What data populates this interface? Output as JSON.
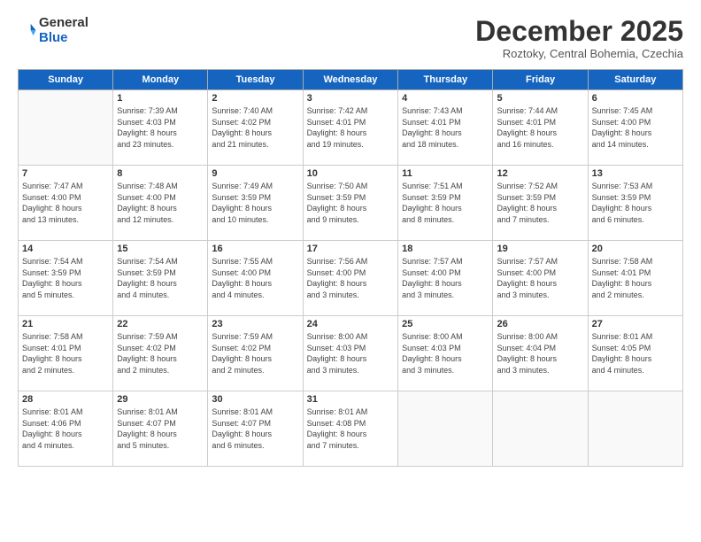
{
  "logo": {
    "general": "General",
    "blue": "Blue"
  },
  "title": "December 2025",
  "location": "Roztoky, Central Bohemia, Czechia",
  "days_of_week": [
    "Sunday",
    "Monday",
    "Tuesday",
    "Wednesday",
    "Thursday",
    "Friday",
    "Saturday"
  ],
  "weeks": [
    [
      {
        "day": "",
        "info": ""
      },
      {
        "day": "1",
        "info": "Sunrise: 7:39 AM\nSunset: 4:03 PM\nDaylight: 8 hours\nand 23 minutes."
      },
      {
        "day": "2",
        "info": "Sunrise: 7:40 AM\nSunset: 4:02 PM\nDaylight: 8 hours\nand 21 minutes."
      },
      {
        "day": "3",
        "info": "Sunrise: 7:42 AM\nSunset: 4:01 PM\nDaylight: 8 hours\nand 19 minutes."
      },
      {
        "day": "4",
        "info": "Sunrise: 7:43 AM\nSunset: 4:01 PM\nDaylight: 8 hours\nand 18 minutes."
      },
      {
        "day": "5",
        "info": "Sunrise: 7:44 AM\nSunset: 4:01 PM\nDaylight: 8 hours\nand 16 minutes."
      },
      {
        "day": "6",
        "info": "Sunrise: 7:45 AM\nSunset: 4:00 PM\nDaylight: 8 hours\nand 14 minutes."
      }
    ],
    [
      {
        "day": "7",
        "info": "Sunrise: 7:47 AM\nSunset: 4:00 PM\nDaylight: 8 hours\nand 13 minutes."
      },
      {
        "day": "8",
        "info": "Sunrise: 7:48 AM\nSunset: 4:00 PM\nDaylight: 8 hours\nand 12 minutes."
      },
      {
        "day": "9",
        "info": "Sunrise: 7:49 AM\nSunset: 3:59 PM\nDaylight: 8 hours\nand 10 minutes."
      },
      {
        "day": "10",
        "info": "Sunrise: 7:50 AM\nSunset: 3:59 PM\nDaylight: 8 hours\nand 9 minutes."
      },
      {
        "day": "11",
        "info": "Sunrise: 7:51 AM\nSunset: 3:59 PM\nDaylight: 8 hours\nand 8 minutes."
      },
      {
        "day": "12",
        "info": "Sunrise: 7:52 AM\nSunset: 3:59 PM\nDaylight: 8 hours\nand 7 minutes."
      },
      {
        "day": "13",
        "info": "Sunrise: 7:53 AM\nSunset: 3:59 PM\nDaylight: 8 hours\nand 6 minutes."
      }
    ],
    [
      {
        "day": "14",
        "info": "Sunrise: 7:54 AM\nSunset: 3:59 PM\nDaylight: 8 hours\nand 5 minutes."
      },
      {
        "day": "15",
        "info": "Sunrise: 7:54 AM\nSunset: 3:59 PM\nDaylight: 8 hours\nand 4 minutes."
      },
      {
        "day": "16",
        "info": "Sunrise: 7:55 AM\nSunset: 4:00 PM\nDaylight: 8 hours\nand 4 minutes."
      },
      {
        "day": "17",
        "info": "Sunrise: 7:56 AM\nSunset: 4:00 PM\nDaylight: 8 hours\nand 3 minutes."
      },
      {
        "day": "18",
        "info": "Sunrise: 7:57 AM\nSunset: 4:00 PM\nDaylight: 8 hours\nand 3 minutes."
      },
      {
        "day": "19",
        "info": "Sunrise: 7:57 AM\nSunset: 4:00 PM\nDaylight: 8 hours\nand 3 minutes."
      },
      {
        "day": "20",
        "info": "Sunrise: 7:58 AM\nSunset: 4:01 PM\nDaylight: 8 hours\nand 2 minutes."
      }
    ],
    [
      {
        "day": "21",
        "info": "Sunrise: 7:58 AM\nSunset: 4:01 PM\nDaylight: 8 hours\nand 2 minutes."
      },
      {
        "day": "22",
        "info": "Sunrise: 7:59 AM\nSunset: 4:02 PM\nDaylight: 8 hours\nand 2 minutes."
      },
      {
        "day": "23",
        "info": "Sunrise: 7:59 AM\nSunset: 4:02 PM\nDaylight: 8 hours\nand 2 minutes."
      },
      {
        "day": "24",
        "info": "Sunrise: 8:00 AM\nSunset: 4:03 PM\nDaylight: 8 hours\nand 3 minutes."
      },
      {
        "day": "25",
        "info": "Sunrise: 8:00 AM\nSunset: 4:03 PM\nDaylight: 8 hours\nand 3 minutes."
      },
      {
        "day": "26",
        "info": "Sunrise: 8:00 AM\nSunset: 4:04 PM\nDaylight: 8 hours\nand 3 minutes."
      },
      {
        "day": "27",
        "info": "Sunrise: 8:01 AM\nSunset: 4:05 PM\nDaylight: 8 hours\nand 4 minutes."
      }
    ],
    [
      {
        "day": "28",
        "info": "Sunrise: 8:01 AM\nSunset: 4:06 PM\nDaylight: 8 hours\nand 4 minutes."
      },
      {
        "day": "29",
        "info": "Sunrise: 8:01 AM\nSunset: 4:07 PM\nDaylight: 8 hours\nand 5 minutes."
      },
      {
        "day": "30",
        "info": "Sunrise: 8:01 AM\nSunset: 4:07 PM\nDaylight: 8 hours\nand 6 minutes."
      },
      {
        "day": "31",
        "info": "Sunrise: 8:01 AM\nSunset: 4:08 PM\nDaylight: 8 hours\nand 7 minutes."
      },
      {
        "day": "",
        "info": ""
      },
      {
        "day": "",
        "info": ""
      },
      {
        "day": "",
        "info": ""
      }
    ]
  ]
}
